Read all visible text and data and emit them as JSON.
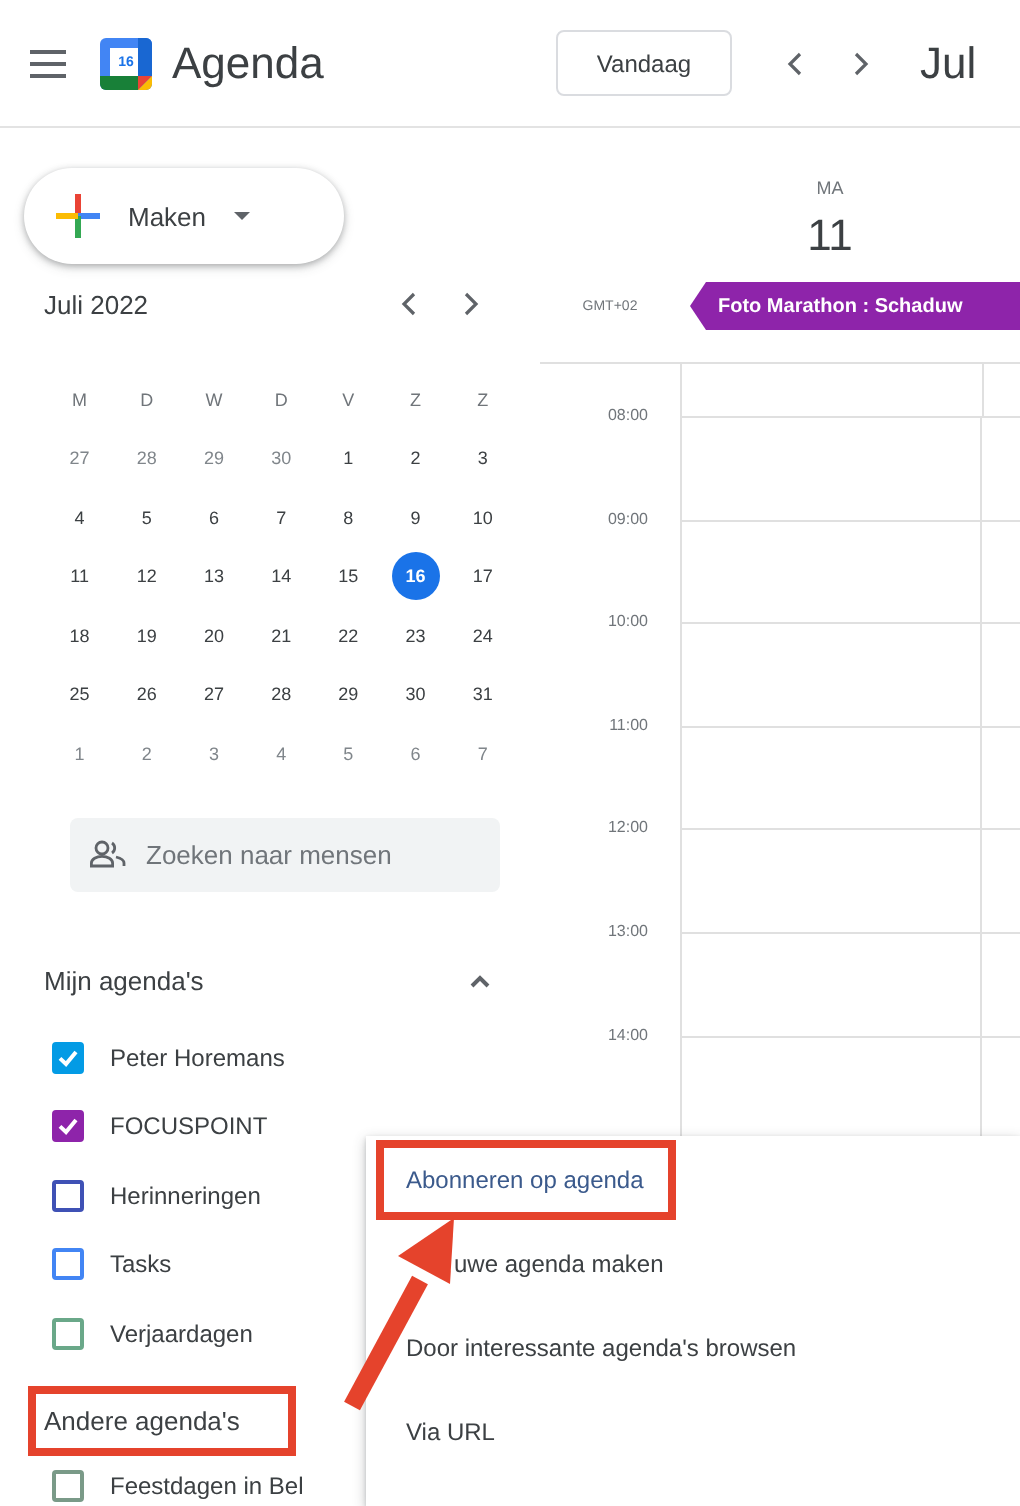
{
  "header": {
    "logo_day": "16",
    "app_title": "Agenda",
    "today_button": "Vandaag",
    "period_title": "Jul"
  },
  "create_button": {
    "label": "Maken"
  },
  "mini_calendar": {
    "title": "Juli 2022",
    "weekdays": [
      "M",
      "D",
      "W",
      "D",
      "V",
      "Z",
      "Z"
    ],
    "weeks": [
      [
        {
          "day": "27",
          "outside_month": true,
          "selected": false
        },
        {
          "day": "28",
          "outside_month": true,
          "selected": false
        },
        {
          "day": "29",
          "outside_month": true,
          "selected": false
        },
        {
          "day": "30",
          "outside_month": true,
          "selected": false
        },
        {
          "day": "1",
          "outside_month": false,
          "selected": false
        },
        {
          "day": "2",
          "outside_month": false,
          "selected": false
        },
        {
          "day": "3",
          "outside_month": false,
          "selected": false
        }
      ],
      [
        {
          "day": "4",
          "outside_month": false,
          "selected": false
        },
        {
          "day": "5",
          "outside_month": false,
          "selected": false
        },
        {
          "day": "6",
          "outside_month": false,
          "selected": false
        },
        {
          "day": "7",
          "outside_month": false,
          "selected": false
        },
        {
          "day": "8",
          "outside_month": false,
          "selected": false
        },
        {
          "day": "9",
          "outside_month": false,
          "selected": false
        },
        {
          "day": "10",
          "outside_month": false,
          "selected": false
        }
      ],
      [
        {
          "day": "11",
          "outside_month": false,
          "selected": false
        },
        {
          "day": "12",
          "outside_month": false,
          "selected": false
        },
        {
          "day": "13",
          "outside_month": false,
          "selected": false
        },
        {
          "day": "14",
          "outside_month": false,
          "selected": false
        },
        {
          "day": "15",
          "outside_month": false,
          "selected": false
        },
        {
          "day": "16",
          "outside_month": false,
          "selected": true
        },
        {
          "day": "17",
          "outside_month": false,
          "selected": false
        }
      ],
      [
        {
          "day": "18",
          "outside_month": false,
          "selected": false
        },
        {
          "day": "19",
          "outside_month": false,
          "selected": false
        },
        {
          "day": "20",
          "outside_month": false,
          "selected": false
        },
        {
          "day": "21",
          "outside_month": false,
          "selected": false
        },
        {
          "day": "22",
          "outside_month": false,
          "selected": false
        },
        {
          "day": "23",
          "outside_month": false,
          "selected": false
        },
        {
          "day": "24",
          "outside_month": false,
          "selected": false
        }
      ],
      [
        {
          "day": "25",
          "outside_month": false,
          "selected": false
        },
        {
          "day": "26",
          "outside_month": false,
          "selected": false
        },
        {
          "day": "27",
          "outside_month": false,
          "selected": false
        },
        {
          "day": "28",
          "outside_month": false,
          "selected": false
        },
        {
          "day": "29",
          "outside_month": false,
          "selected": false
        },
        {
          "day": "30",
          "outside_month": false,
          "selected": false
        },
        {
          "day": "31",
          "outside_month": false,
          "selected": false
        }
      ],
      [
        {
          "day": "1",
          "outside_month": true,
          "selected": false
        },
        {
          "day": "2",
          "outside_month": true,
          "selected": false
        },
        {
          "day": "3",
          "outside_month": true,
          "selected": false
        },
        {
          "day": "4",
          "outside_month": true,
          "selected": false
        },
        {
          "day": "5",
          "outside_month": true,
          "selected": false
        },
        {
          "day": "6",
          "outside_month": true,
          "selected": false
        },
        {
          "day": "7",
          "outside_month": true,
          "selected": false
        }
      ]
    ]
  },
  "people_search": {
    "placeholder": "Zoeken naar mensen"
  },
  "my_calendars": {
    "title": "Mijn agenda's",
    "expanded": true,
    "highlighted": false,
    "items": [
      {
        "name": "Peter Horemans",
        "checked": true,
        "color": "#039be5"
      },
      {
        "name": "FOCUSPOINT",
        "checked": true,
        "color": "#8e24aa"
      },
      {
        "name": "Herinneringen",
        "checked": false,
        "color": "#3f51b5"
      },
      {
        "name": "Tasks",
        "checked": false,
        "color": "#4285f4"
      },
      {
        "name": "Verjaardagen",
        "checked": false,
        "color": "#6aa889"
      }
    ]
  },
  "other_calendars": {
    "title": "Andere agenda's",
    "highlighted": true,
    "items": [
      {
        "name": "Feestdagen in Bel",
        "checked": false,
        "color": "#7a9a88"
      }
    ]
  },
  "day_view": {
    "weekday": "MA",
    "day": "11",
    "timezone": "GMT+02",
    "all_day_events": [
      {
        "title": "Foto Marathon : Schaduw"
      }
    ],
    "hours": [
      "08:00",
      "09:00",
      "10:00",
      "11:00",
      "12:00",
      "13:00",
      "14:00"
    ]
  },
  "context_menu": {
    "items": [
      {
        "label": "Abonneren op agenda",
        "kind": "full",
        "highlighted": true
      },
      {
        "label": "uwe agenda maken",
        "kind": "partly_covered",
        "highlighted": false
      },
      {
        "label": "Door interessante agenda's browsen",
        "kind": "full",
        "highlighted": false
      },
      {
        "label": "Via URL",
        "kind": "full",
        "highlighted": false
      }
    ]
  }
}
